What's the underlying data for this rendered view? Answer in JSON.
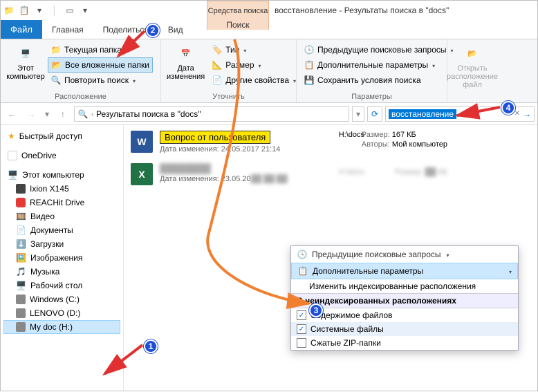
{
  "window": {
    "context_tab": "Средства поиска",
    "title": "восстановление - Результаты поиска в \"docs\""
  },
  "tabs": {
    "file": "Файл",
    "home": "Главная",
    "share": "Поделиться",
    "view": "Вид",
    "search": "Поиск"
  },
  "ribbon": {
    "location": {
      "this_pc": "Этот\nкомпьютер",
      "current_folder": "Текущая папка",
      "all_subfolders": "Все вложенные папки",
      "repeat_search": "Повторить поиск",
      "group_label": "Расположение"
    },
    "refine": {
      "date_modified": "Дата\nизменения",
      "type": "Тип",
      "size": "Размер",
      "other_props": "Другие свойства",
      "group_label": "Уточнить"
    },
    "options": {
      "recent_searches": "Предыдущие поисковые запросы",
      "advanced": "Дополнительные параметры",
      "save_search": "Сохранить условия поиска",
      "group_label": "Параметры"
    },
    "open": {
      "open_location": "Открыть\nрасположение файл"
    }
  },
  "addressbar": {
    "text": "Результаты поиска в \"docs\""
  },
  "searchbox": {
    "query": "восстановление"
  },
  "sidebar": {
    "quick_access": "Быстрый доступ",
    "onedrive": "OneDrive",
    "this_pc": "Этот компьютер",
    "items": [
      "Ixion X145",
      "REACHit Drive",
      "Видео",
      "Документы",
      "Загрузки",
      "Изображения",
      "Музыка",
      "Рабочий стол",
      "Windows (C:)",
      "LENOVO (D:)",
      "My doc (H:)"
    ]
  },
  "results": {
    "item1": {
      "filename": "Вопрос от пользователя",
      "date_label": "Дата изменения:",
      "date_value": "24.05.2017 21:14",
      "path_label": "H:\\docs",
      "size_label": "Размер:",
      "size_value": "167 КБ",
      "authors_label": "Авторы:",
      "authors_value": "Мой компьютер"
    },
    "item2": {
      "date_label": "Дата изменения:",
      "date_value_partial": "23.05.20"
    }
  },
  "popup": {
    "recent_searches": "Предыдущие поисковые запросы",
    "advanced": "Дополнительные параметры",
    "change_indexed": "Изменить индексированные расположения",
    "section_title": "В неиндексированных расположениях",
    "opt_contents": "Содержимое файлов",
    "opt_system": "Системные файлы",
    "opt_zip": "Сжатые ZIP-папки"
  },
  "badges": {
    "b1": "1",
    "b2": "2",
    "b3": "3",
    "b4": "4"
  }
}
